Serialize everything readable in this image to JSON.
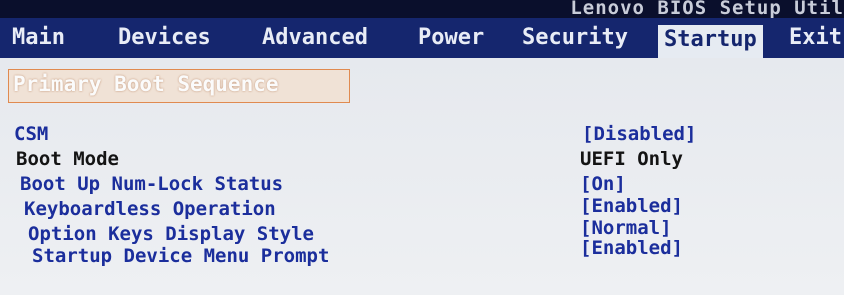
{
  "header": {
    "bios_title": "Lenovo BIOS Setup Util"
  },
  "menu": {
    "items": [
      {
        "label": "Main"
      },
      {
        "label": "Devices"
      },
      {
        "label": "Advanced"
      },
      {
        "label": "Power"
      },
      {
        "label": "Security"
      },
      {
        "label": "Startup",
        "selected": true
      },
      {
        "label": "Exit"
      }
    ]
  },
  "section": {
    "title": "Primary Boot Sequence"
  },
  "settings": [
    {
      "label": "CSM",
      "value": "[Disabled]",
      "editable": true
    },
    {
      "label": "Boot Mode",
      "value": "UEFI Only",
      "editable": false
    },
    {
      "label": "Boot Up Num-Lock Status",
      "value": "[On]",
      "editable": true
    },
    {
      "label": "Keyboardless Operation",
      "value": "[Enabled]",
      "editable": true
    },
    {
      "label": "Option Keys Display Style",
      "value": "[Normal]",
      "editable": true
    },
    {
      "label": "Startup Device Menu Prompt",
      "value": "[Enabled]",
      "editable": true
    }
  ],
  "colors": {
    "menubar_bg": "#15266e",
    "selected_tab_bg": "#e6ebf2",
    "option_text": "#1b2e9c",
    "readonly_text": "#141414",
    "highlight_border": "#e08a50"
  }
}
